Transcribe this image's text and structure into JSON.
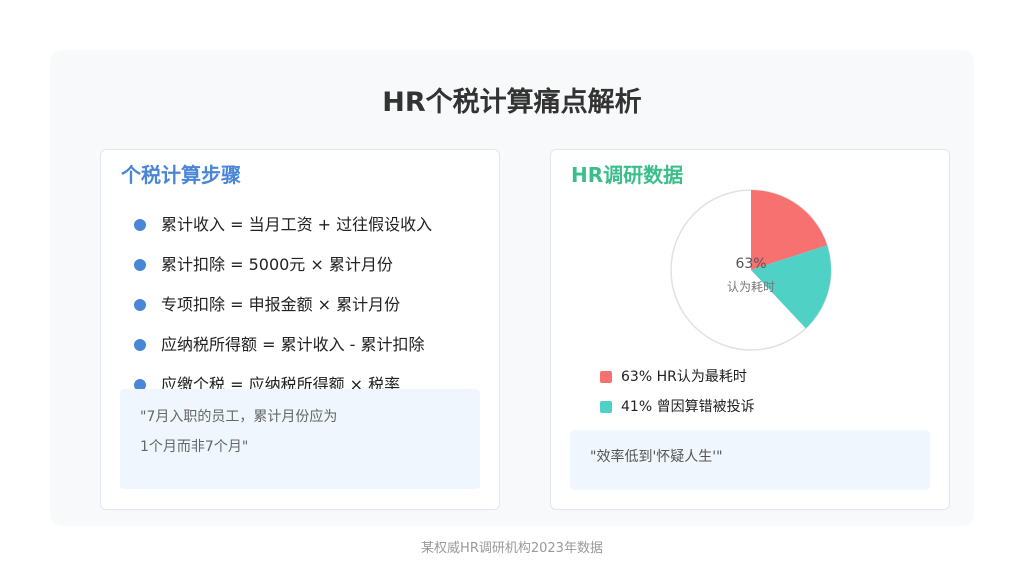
{
  "page": {
    "title": "HR个税计算痛点解析",
    "footer": "某权威HR调研机构2023年数据"
  },
  "left_card": {
    "title": "个税计算步骤",
    "steps": [
      "累计收入 = 当月工资 + 过往假设收入",
      "累计扣除 = 5000元 × 累计月份",
      "专项扣除 = 申报金额 × 累计月份",
      "应纳税所得额 = 累计收入 - 累计扣除",
      "应缴个税 = 应纳税所得额 × 税率"
    ],
    "quote_line1": "\"7月入职的员工，累计月份应为",
    "quote_line2": "1个月而非7个月\""
  },
  "right_card": {
    "title": "HR调研数据",
    "quote": "\"效率低到'怀疑人生'\""
  },
  "chart_data": {
    "type": "pie",
    "title": "",
    "center_value": "63%",
    "center_label": "认为耗时",
    "series": [
      {
        "name": "63% HR认为最耗时",
        "value": 63,
        "drawn_share": 20,
        "color": "#f87171"
      },
      {
        "name": "41% 曾因算错被投诉",
        "value": 41,
        "drawn_share": 18,
        "color": "#4fd1c5"
      }
    ],
    "remainder_color": "#ffffff",
    "outline_color": "#e2e2e2",
    "legend_position": "bottom-left"
  }
}
